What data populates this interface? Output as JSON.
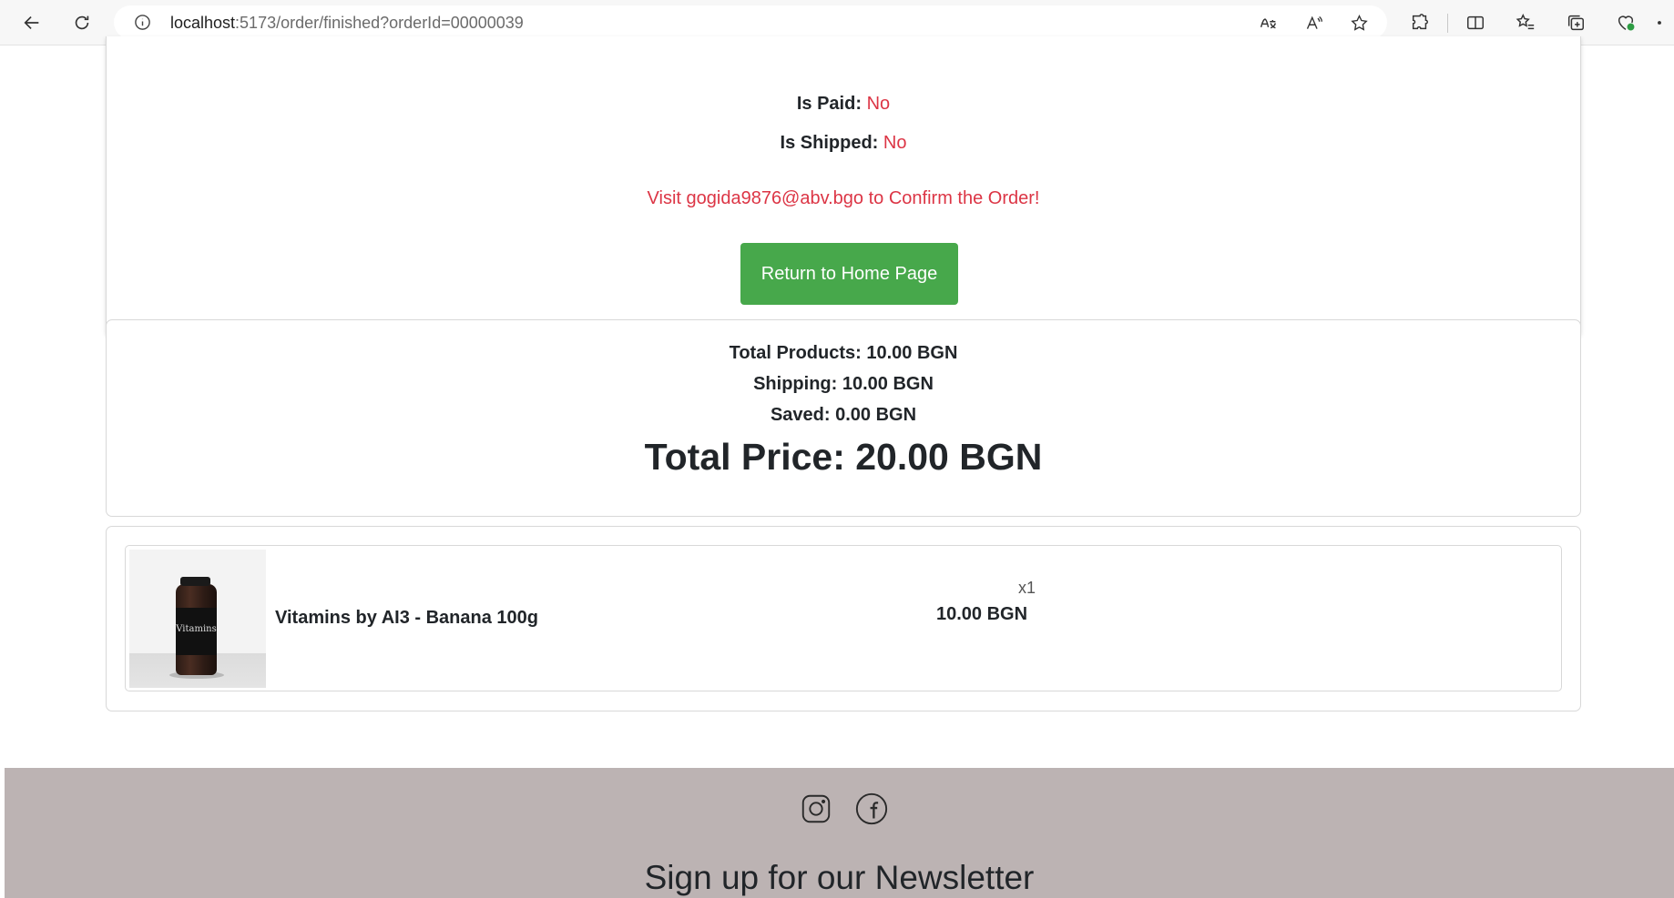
{
  "browser": {
    "url_host": "localhost",
    "url_rest": ":5173/order/finished?orderId=00000039"
  },
  "order_status": {
    "paid_label": "Is Paid:",
    "paid_value": "No",
    "shipped_label": "Is Shipped:",
    "shipped_value": "No",
    "confirm_message": "Visit gogida9876@abv.bgo to Confirm the Order!",
    "home_button": "Return to Home Page"
  },
  "summary": {
    "total_products": "Total Products: 10.00 BGN",
    "shipping": "Shipping: 10.00 BGN",
    "saved": "Saved: 0.00 BGN",
    "total_price": "Total Price: 20.00 BGN"
  },
  "items": [
    {
      "name": "Vitamins by AI3 - Banana 100g",
      "quantity": "x1",
      "price": "10.00 BGN",
      "image_text": "Vitamins"
    }
  ],
  "footer": {
    "social": [
      "instagram-icon",
      "facebook-icon"
    ],
    "newsletter_title": "Sign up for our Newsletter"
  },
  "colors": {
    "status_red": "#dc3545",
    "button_green": "#47a84b",
    "footer_bg": "#bcb3b3"
  }
}
